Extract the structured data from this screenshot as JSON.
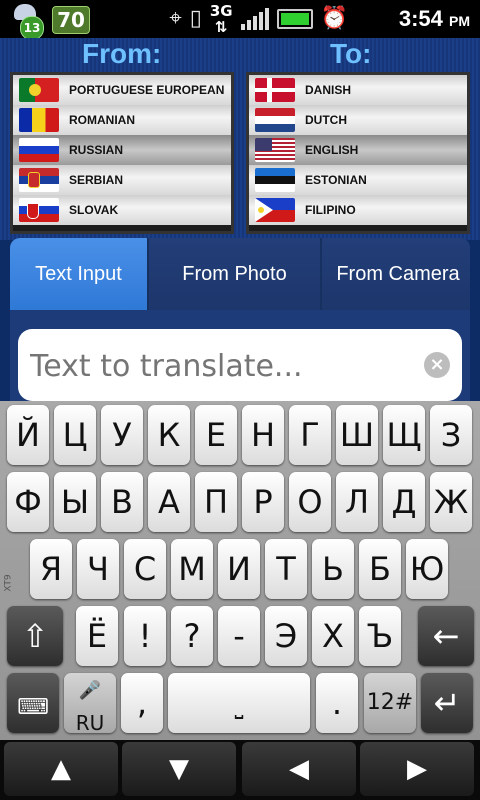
{
  "status_bar": {
    "badge_count": "13",
    "app_badge": "70",
    "network": "3G",
    "time": "3:54",
    "ampm": "PM"
  },
  "from_label": "From:",
  "to_label": "To:",
  "from_languages": [
    {
      "name": "PORTUGUESE EUROPEAN",
      "selected": false
    },
    {
      "name": "ROMANIAN",
      "selected": false
    },
    {
      "name": "RUSSIAN",
      "selected": true
    },
    {
      "name": "SERBIAN",
      "selected": false
    },
    {
      "name": "SLOVAK",
      "selected": false
    }
  ],
  "to_languages": [
    {
      "name": "DANISH",
      "selected": false
    },
    {
      "name": "DUTCH",
      "selected": false
    },
    {
      "name": "ENGLISH",
      "selected": true
    },
    {
      "name": "ESTONIAN",
      "selected": false
    },
    {
      "name": "FILIPINO",
      "selected": false
    }
  ],
  "tabs": [
    {
      "label": "Text Input",
      "active": true
    },
    {
      "label": "From Photo",
      "active": false
    },
    {
      "label": "From Camera",
      "active": false
    }
  ],
  "text_input": {
    "value": "",
    "placeholder": "Text to translate..."
  },
  "keyboard": {
    "row1": [
      "Й",
      "Ц",
      "У",
      "К",
      "Е",
      "Н",
      "Г",
      "Ш",
      "Щ",
      "З"
    ],
    "row2": [
      "Ф",
      "Ы",
      "В",
      "А",
      "П",
      "Р",
      "О",
      "Л",
      "Д",
      "Ж"
    ],
    "row3": [
      "Я",
      "Ч",
      "С",
      "М",
      "И",
      "Т",
      "Ь",
      "Б",
      "Ю"
    ],
    "row4": [
      "Ё",
      "!",
      "?",
      "-",
      "Э",
      "Х",
      "Ъ"
    ],
    "lang_key": "RU",
    "comma": ",",
    "period": ".",
    "symbols": "12#",
    "side_label": "XT9"
  }
}
